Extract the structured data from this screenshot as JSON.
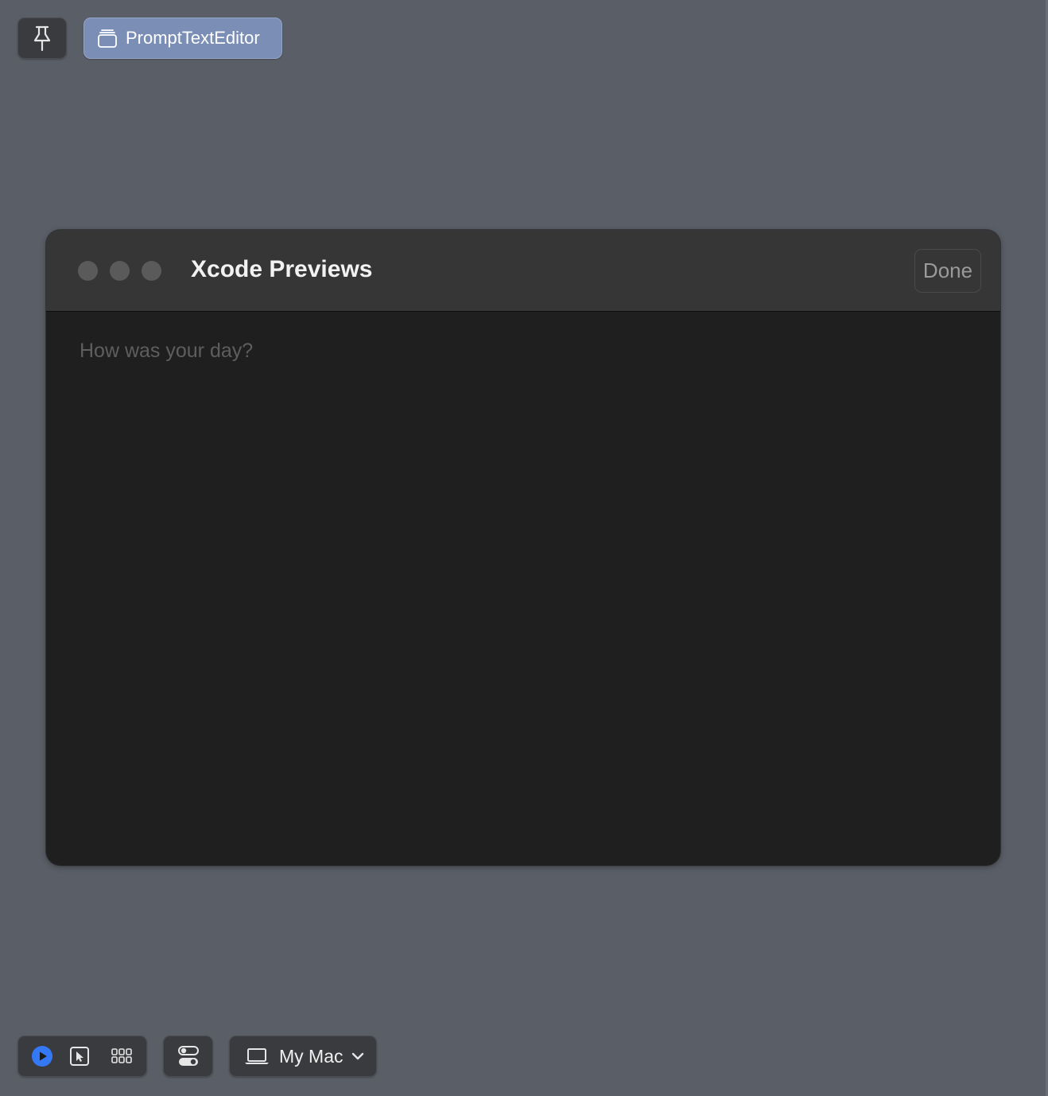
{
  "toolbar": {
    "pin_icon": "pin-icon",
    "preview_tab": {
      "icon": "stack-window-icon",
      "label": "PromptTextEditor"
    }
  },
  "window": {
    "title": "Xcode Previews",
    "done_label": "Done",
    "traffic_lights": [
      "close",
      "minimize",
      "zoom"
    ],
    "traffic_light_color": "#5a5a5a",
    "editor": {
      "placeholder": "How was your day?"
    }
  },
  "bottom_bar": {
    "modes": [
      {
        "name": "live-mode",
        "icon": "play-circle-icon",
        "active": true
      },
      {
        "name": "selectable-mode",
        "icon": "cursor-select-icon",
        "active": false
      },
      {
        "name": "variants-grid",
        "icon": "grid-icon",
        "active": false
      }
    ],
    "variants_icon": "toggles-icon",
    "device": {
      "icon": "laptop-icon",
      "label": "My Mac"
    }
  },
  "colors": {
    "background": "#5a5e66",
    "accent": "#3478f6",
    "tab_selected": "#7b8fb6",
    "window_bg": "#1f1f1f",
    "titlebar_bg": "#363636"
  }
}
